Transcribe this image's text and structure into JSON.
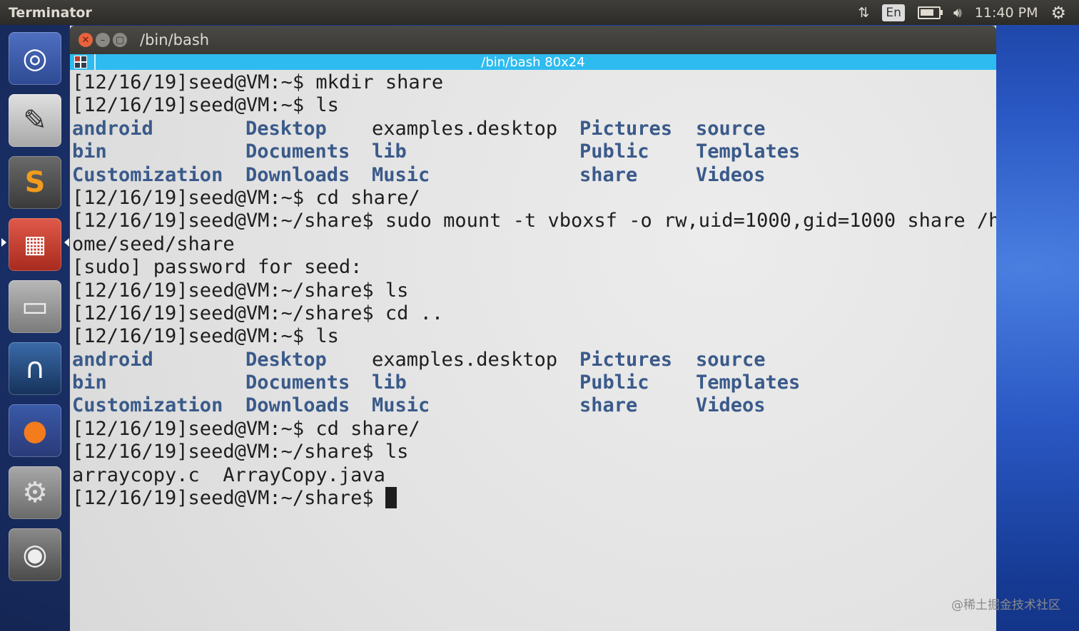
{
  "top_panel": {
    "app_name": "Terminator",
    "lang": "En",
    "clock": "11:40 PM"
  },
  "launcher": {
    "items": [
      {
        "name": "ubuntu-dash",
        "icon": "ubuntu-logo-icon",
        "color": "#3b5aa8"
      },
      {
        "name": "text-editor",
        "icon": "text-editor-icon",
        "color": "#c8c8c8"
      },
      {
        "name": "sublime-text",
        "icon": "sublime-text-icon",
        "color": "#4a4a4a"
      },
      {
        "name": "terminator",
        "icon": "terminator-icon",
        "color": "#c0392b",
        "active": true
      },
      {
        "name": "file-manager",
        "icon": "file-cabinet-icon",
        "color": "#7a7a7a"
      },
      {
        "name": "wireshark",
        "icon": "wireshark-fin-icon",
        "color": "#1f3d66"
      },
      {
        "name": "firefox",
        "icon": "firefox-icon",
        "color": "#e86a1a"
      },
      {
        "name": "system-settings",
        "icon": "settings-wrench-icon",
        "color": "#8a8a8a"
      },
      {
        "name": "dvd-drive",
        "icon": "disc-icon",
        "color": "#6a6a6a"
      }
    ]
  },
  "window": {
    "title": "/bin/bash",
    "tab_label": "/bin/bash 80x24"
  },
  "terminal": {
    "lines": [
      "[12/16/19]seed@VM:~$ mkdir share",
      "[12/16/19]seed@VM:~$ ls"
    ],
    "ls_output_1": [
      [
        "android",
        "Desktop",
        "examples.desktop",
        "Pictures",
        "source"
      ],
      [
        "bin",
        "Documents",
        "lib",
        "Public",
        "Templates"
      ],
      [
        "Customization",
        "Downloads",
        "Music",
        "share",
        "Videos"
      ]
    ],
    "lines_2": [
      "[12/16/19]seed@VM:~$ cd share/",
      "[12/16/19]seed@VM:~/share$ sudo mount -t vboxsf -o rw,uid=1000,gid=1000 share /h",
      "ome/seed/share",
      "[sudo] password for seed:",
      "[12/16/19]seed@VM:~/share$ ls",
      "[12/16/19]seed@VM:~/share$ cd ..",
      "[12/16/19]seed@VM:~$ ls"
    ],
    "ls_output_2": [
      [
        "android",
        "Desktop",
        "examples.desktop",
        "Pictures",
        "source"
      ],
      [
        "bin",
        "Documents",
        "lib",
        "Public",
        "Templates"
      ],
      [
        "Customization",
        "Downloads",
        "Music",
        "share",
        "Videos"
      ]
    ],
    "lines_3": [
      "[12/16/19]seed@VM:~$ cd share/",
      "[12/16/19]seed@VM:~/share$ ls",
      "arraycopy.c  ArrayCopy.java"
    ],
    "prompt": "[12/16/19]seed@VM:~/share$ "
  },
  "watermark": "@稀土掘金技术社区",
  "colors": {
    "dir_color": "#3a5a8a",
    "tab_bar": "#2ebbf0",
    "close_button": "#e8623e"
  }
}
